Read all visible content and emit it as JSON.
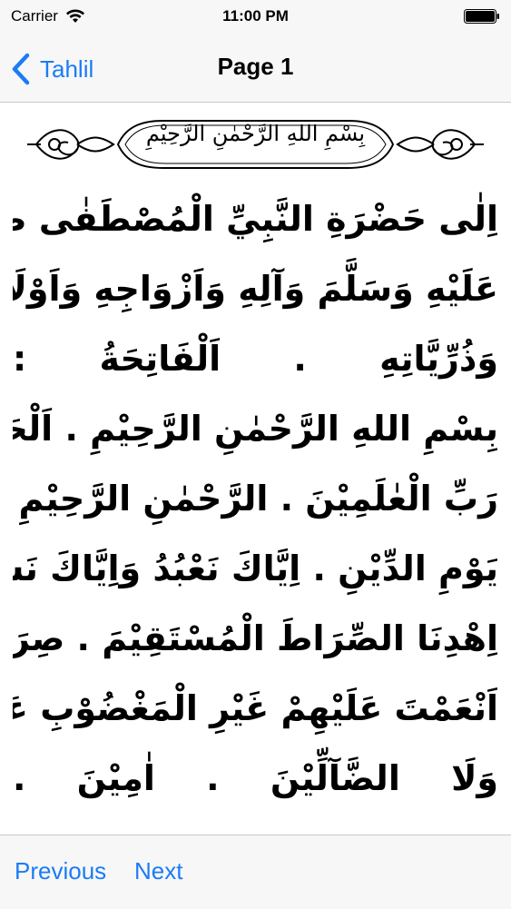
{
  "status_bar": {
    "carrier": "Carrier",
    "time": "11:00 PM",
    "icons": [
      "wifi-icon",
      "battery-icon"
    ]
  },
  "nav": {
    "back_label": "Tahlil",
    "title": "Page 1",
    "back_icon": "chevron-left-icon"
  },
  "content": {
    "header_basmala": "بِسْمِ اللهِ الرَّحْمٰنِ الرَّحِيْمِ",
    "lines": [
      "اِلٰى حَضْرَةِ النَّبِيِّ الْمُصْطَفٰى صَلَّى اللهُ",
      "عَلَيْهِ وَسَلَّمَ وَآلِهِ وَاَزْوَاجِهِ وَاَوْلَادِهِ",
      "وَذُرِّيَّاتِهِ . اَلْفَاتِحَةُ :",
      "بِسْمِ اللهِ الرَّحْمٰنِ الرَّحِيْمِ . اَلْحَمْدُ لِلّٰهِ",
      "رَبِّ الْعٰلَمِيْنَ . الرَّحْمٰنِ الرَّحِيْمِ . مٰلِكِ",
      "يَوْمِ الدِّيْنِ . اِيَّاكَ نَعْبُدُ وَاِيَّاكَ نَسْتَعِيْنُ .",
      "اِهْدِنَا الصِّرَاطَ الْمُسْتَقِيْمَ . صِرَاطَ الَّذِيْنَ",
      "اَنْعَمْتَ عَلَيْهِمْ غَيْرِ الْمَغْضُوْبِ عَلَيْهِمْ",
      "وَلَا الضَّآلِّيْنَ . اٰمِيْنَ ."
    ]
  },
  "toolbar": {
    "previous_label": "Previous",
    "next_label": "Next"
  },
  "colors": {
    "accent": "#1a7cf6",
    "bar_background": "#f7f7f7",
    "separator": "#c8c8cc"
  }
}
